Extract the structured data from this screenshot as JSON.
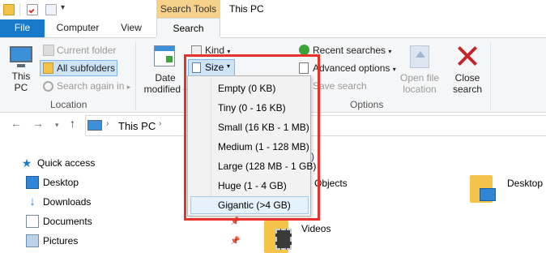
{
  "window": {
    "title": "This PC"
  },
  "contextual_tab": "Search Tools",
  "tabs": {
    "file": "File",
    "computer": "Computer",
    "view": "View",
    "search": "Search"
  },
  "ribbon": {
    "this_pc": [
      "This",
      "PC"
    ],
    "current_folder": "Current folder",
    "all_subfolders": "All subfolders",
    "search_again_in": "Search again in",
    "location_group": "Location",
    "date_modified": [
      "Date",
      "modified"
    ],
    "kind": "Kind",
    "size": "Size",
    "recent_searches": "Recent searches",
    "advanced_options": "Advanced options",
    "save_search": "Save search",
    "open_file_location": [
      "Open file",
      "location"
    ],
    "close_search": [
      "Close",
      "search"
    ],
    "options_group": "Options"
  },
  "address": {
    "path": "This PC"
  },
  "nav_pane": {
    "quick_access": "Quick access",
    "items": [
      "Desktop",
      "Downloads",
      "Documents",
      "Pictures"
    ]
  },
  "content": {
    "objects_label": "Objects",
    "desktop_label": "Desktop",
    "videos_label": "Videos"
  },
  "size_menu": {
    "items": [
      "Empty (0 KB)",
      "Tiny (0 - 16 KB)",
      "Small (16 KB - 1 MB)",
      "Medium (1 - 128 MB)",
      "Large (128 MB - 1 GB)",
      "Huge (1 - 4 GB)",
      "Gigantic (>4 GB)"
    ],
    "highlighted_index": 6
  },
  "colors": {
    "file_tab": "#1979ca",
    "contextual": "#f7d08a",
    "highlight_box": "#e6322a"
  }
}
